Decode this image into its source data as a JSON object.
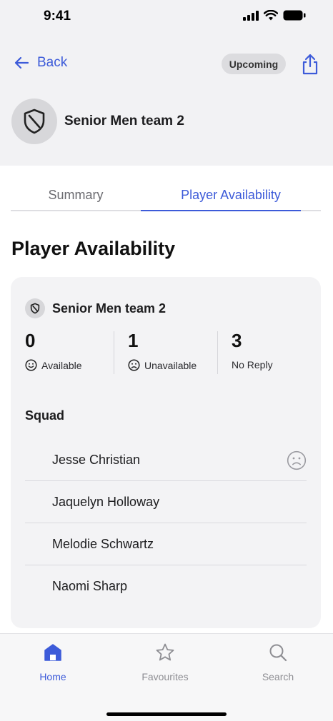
{
  "status_bar": {
    "time": "9:41"
  },
  "header": {
    "back_label": "Back",
    "badge": "Upcoming",
    "team_name": "Senior Men team 2"
  },
  "tabs": [
    {
      "label": "Summary",
      "active": false
    },
    {
      "label": "Player Availability",
      "active": true
    }
  ],
  "section_title": "Player Availability",
  "card": {
    "team_name": "Senior Men team 2",
    "stats": [
      {
        "count": "0",
        "label": "Available",
        "icon": "smile-icon"
      },
      {
        "count": "1",
        "label": "Unavailable",
        "icon": "frown-icon"
      },
      {
        "count": "3",
        "label": "No Reply",
        "icon": ""
      }
    ],
    "squad_title": "Squad",
    "players": [
      {
        "name": "Jesse Christian",
        "status_icon": "frown-icon"
      },
      {
        "name": "Jaquelyn Holloway",
        "status_icon": ""
      },
      {
        "name": "Melodie Schwartz",
        "status_icon": ""
      },
      {
        "name": "Naomi Sharp",
        "status_icon": ""
      }
    ]
  },
  "tabbar": [
    {
      "label": "Home",
      "icon": "home-icon",
      "active": true
    },
    {
      "label": "Favourites",
      "icon": "star-icon",
      "active": false
    },
    {
      "label": "Search",
      "icon": "search-icon",
      "active": false
    }
  ],
  "colors": {
    "accent": "#3d5bd9",
    "background": "#f2f2f4",
    "card": "#f3f3f5"
  }
}
